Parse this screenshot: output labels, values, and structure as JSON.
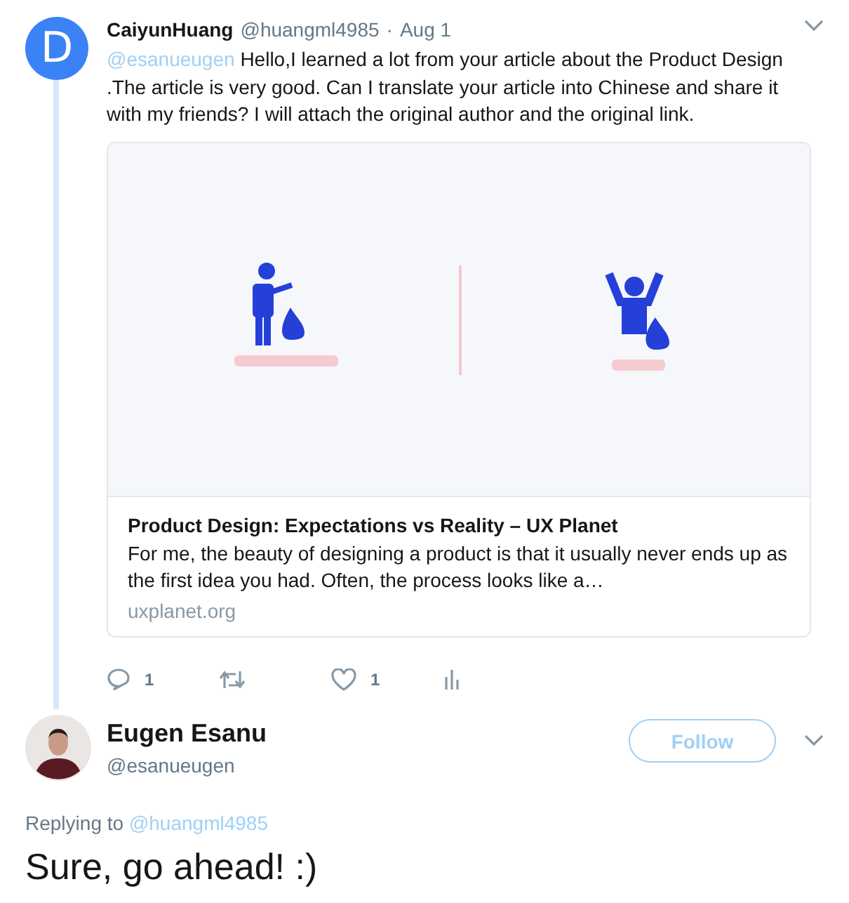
{
  "tweet": {
    "avatar_letter": "D",
    "name": "CaiyunHuang",
    "handle": "@huangml4985",
    "separator": "·",
    "date": "Aug 1",
    "mention": "@esanueugen",
    "text": "Hello,I learned a lot from your article about the Product Design .The article is very good. Can I translate your article into Chinese and share it with my friends? I will attach the original author and the original link.",
    "card": {
      "title": "Product Design: Expectations vs Reality – UX Planet",
      "description": "For me, the beauty of designing a product is that it usually never ends up as the first idea you had. Often, the process looks like a…",
      "domain": "uxplanet.org"
    },
    "actions": [
      {
        "kind": "reply",
        "count": "1"
      },
      {
        "kind": "retweet"
      },
      {
        "kind": "like",
        "count": "1"
      },
      {
        "kind": "stats"
      }
    ]
  },
  "reply": {
    "name": "Eugen Esanu",
    "handle": "@esanueugen",
    "follow_label": "Follow",
    "replying_label": "Replying to",
    "replying_handle": "@huangml4985",
    "text": "Sure, go ahead! :)"
  }
}
